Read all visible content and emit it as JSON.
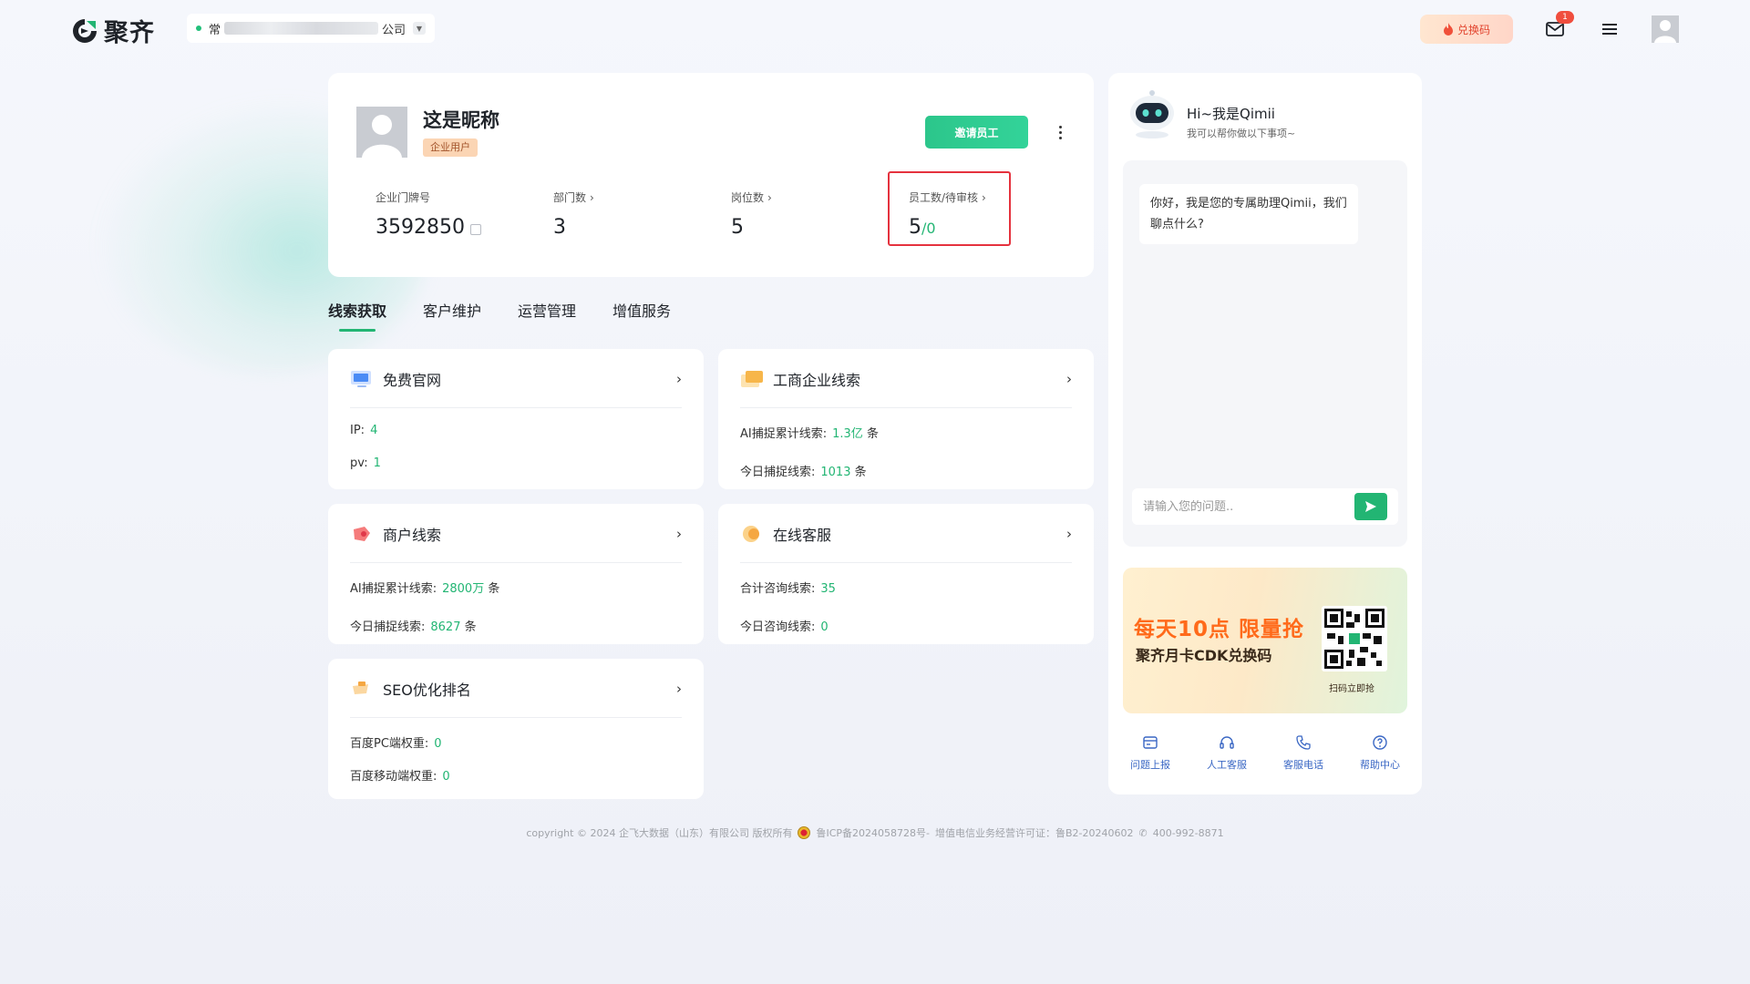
{
  "header": {
    "logo_text": "聚齐",
    "company": {
      "prefix": "常",
      "suffix": "公司"
    },
    "redeem_label": "兑换码",
    "mail_badge": "1"
  },
  "profile": {
    "nickname": "这是昵称",
    "user_tag": "企业用户",
    "invite_label": "邀请员工",
    "stats": [
      {
        "label": "企业门牌号",
        "value": "3592850"
      },
      {
        "label": "部门数",
        "value": "3"
      },
      {
        "label": "岗位数",
        "value": "5"
      },
      {
        "label": "员工数/待审核",
        "value": "5",
        "pending": "/0"
      }
    ]
  },
  "tabs": [
    "线索获取",
    "客户维护",
    "运营管理",
    "增值服务"
  ],
  "cards": [
    {
      "title": "免费官网",
      "icon": "website-icon",
      "rows": [
        {
          "label": "IP:",
          "value": "4",
          "unit": ""
        },
        {
          "label": "pv:",
          "value": "1",
          "unit": ""
        }
      ]
    },
    {
      "title": "工商企业线索",
      "icon": "enterprise-leads-icon",
      "rows": [
        {
          "label": "AI捕捉累计线索:",
          "value": "1.3亿",
          "unit": "条"
        },
        {
          "label": "今日捕捉线索:",
          "value": "1013",
          "unit": "条"
        }
      ]
    },
    {
      "title": "商户线索",
      "icon": "merchant-leads-icon",
      "rows": [
        {
          "label": "AI捕捉累计线索:",
          "value": "2800万",
          "unit": "条"
        },
        {
          "label": "今日捕捉线索:",
          "value": "8627",
          "unit": "条"
        }
      ]
    },
    {
      "title": "在线客服",
      "icon": "online-service-icon",
      "rows": [
        {
          "label": "合计咨询线索:",
          "value": "35",
          "unit": ""
        },
        {
          "label": "今日咨询线索:",
          "value": "0",
          "unit": ""
        }
      ]
    },
    {
      "title": "SEO优化排名",
      "icon": "seo-ranking-icon",
      "rows": [
        {
          "label": "百度PC端权重:",
          "value": "0",
          "unit": ""
        },
        {
          "label": "百度移动端权重:",
          "value": "0",
          "unit": ""
        }
      ]
    }
  ],
  "chat": {
    "greeting": "Hi~我是Qimii",
    "subtitle": "我可以帮你做以下事项~",
    "bot_message": "你好，我是您的专属助理Qimii，我们聊点什么?",
    "input_placeholder": "请输入您的问题..",
    "promo": {
      "title": "每天10点 限量抢",
      "subtitle": "聚齐月卡CDK兑换码",
      "qr_caption": "扫码立即抢"
    },
    "quick_links": [
      {
        "label": "问题上报",
        "icon": "report-icon"
      },
      {
        "label": "人工客服",
        "icon": "headset-icon"
      },
      {
        "label": "客服电话",
        "icon": "phone-icon"
      },
      {
        "label": "帮助中心",
        "icon": "help-icon"
      }
    ]
  },
  "footer": {
    "copyright": "copyright © 2024 企飞大数据（山东）有限公司 版权所有",
    "icp": "鲁ICP备2024058728号-",
    "license": "增值电信业务经营许可证：鲁B2-20240602",
    "phone": "400-992-8871"
  },
  "colors": {
    "accent": "#22b573",
    "highlight": "#e5323e",
    "promo": "#ff6a1a"
  }
}
